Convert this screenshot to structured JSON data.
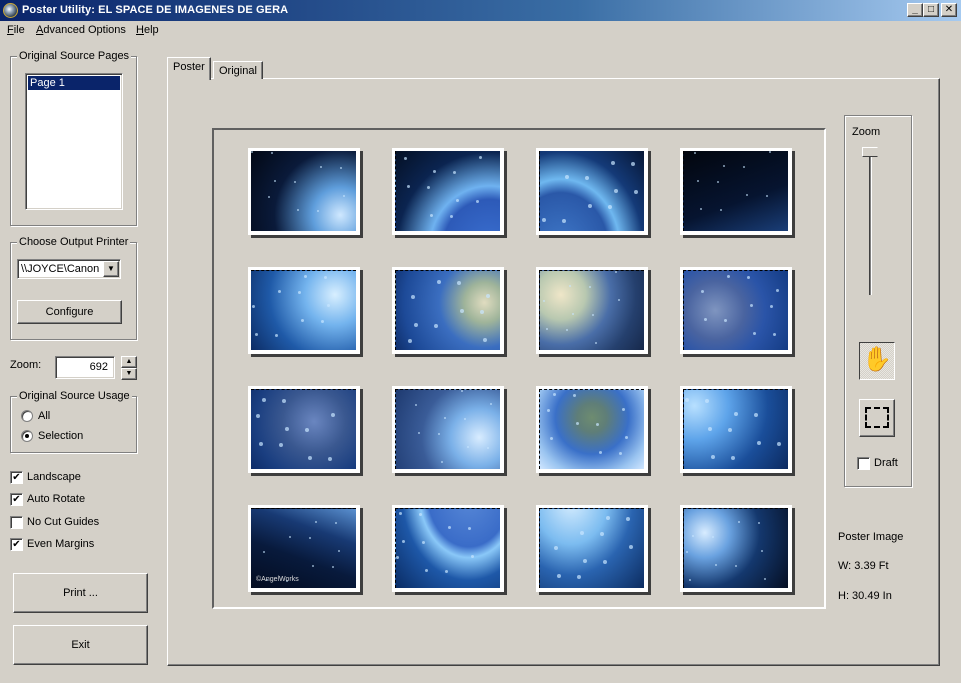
{
  "window": {
    "title": "Poster Utility:  EL SPACE DE IMAGENES DE GERA",
    "controls": {
      "minimize": "_",
      "maximize": "□",
      "close": "✕"
    }
  },
  "menubar": {
    "items": [
      {
        "label": "File",
        "accel": "F",
        "rest": "ile"
      },
      {
        "label": "Advanced Options",
        "accel": "A",
        "rest": "dvanced Options"
      },
      {
        "label": "Help",
        "accel": "H",
        "rest": "elp"
      }
    ]
  },
  "sidebar": {
    "source_pages": {
      "label": "Original Source Pages",
      "items": [
        "Page 1"
      ],
      "selected": "Page 1"
    },
    "printer": {
      "label": "Choose Output Printer",
      "selected": "\\\\JOYCE\\Canon iP",
      "arrow": "▼",
      "configure_label": "Configure"
    },
    "zoom": {
      "label": "Zoom:",
      "value": "692",
      "up": "▲",
      "down": "▼"
    },
    "source_usage": {
      "label": "Original Source Usage",
      "options": [
        {
          "label": "All",
          "selected": false
        },
        {
          "label": "Selection",
          "selected": true
        }
      ]
    },
    "options": [
      {
        "label": "Landscape",
        "checked": true,
        "mark": "✔"
      },
      {
        "label": "Auto Rotate",
        "checked": true,
        "mark": "✔"
      },
      {
        "label": "No Cut Guides",
        "checked": false,
        "mark": ""
      },
      {
        "label": "Even Margins",
        "checked": true,
        "mark": "✔"
      }
    ],
    "print_label": "Print ...",
    "exit_label": "Exit"
  },
  "tabs": [
    {
      "label": "Poster",
      "active": true
    },
    {
      "label": "Original",
      "active": false
    }
  ],
  "poster": {
    "grid_rows": 4,
    "grid_cols": 4,
    "tiles": [
      {
        "desc": "stars and bubbles",
        "bg": "radial-gradient(circle at 85% 80%, #cfe8ff 0%, #5f9edc 25%, #0a1a3a 60%, #020814 100%)"
      },
      {
        "desc": "earth horizon bubbles",
        "bg": "radial-gradient(ellipse at 90% 120%, #3a6fd0 0%, #2d5ab8 35%, #6fb2f0 45%, #0b2450 70%, #041024 100%)"
      },
      {
        "desc": "earth and stars",
        "bg": "radial-gradient(ellipse at 20% 120%, #3f78c8 0%, #2a58a8 40%, #6fb8f0 50%, #143a78 70%, #061634 100%)"
      },
      {
        "desc": "dark space",
        "bg": "linear-gradient(160deg, #02060e 0%, #061430 60%, #1a3e78 100%)"
      },
      {
        "desc": "bubbles and fin",
        "bg": "radial-gradient(circle at 80% 30%, #d8efff 0%, #74b4ee 30%, #1f5aa8 65%, #0c2c64 100%)"
      },
      {
        "desc": "earth with africa",
        "bg": "radial-gradient(circle at 85% 40%, #e0dcc0 0%, #9fb49a 20%, #3b6ec0 45%, #1d4a98 80%, #0f2e6a 100%)"
      },
      {
        "desc": "dolphin over earth",
        "bg": "radial-gradient(circle at 20% 30%, #efe6c8 0%, #b8c8b0 25%, #4a6ea8 50%, #25406e 75%, #16284a 100%)"
      },
      {
        "desc": "dolphin tail",
        "bg": "radial-gradient(circle at 30% 50%, #7f95c0 0%, #4a64a0 35%, #2a54a8 60%, #143c84 100%)"
      },
      {
        "desc": "dolphin body",
        "bg": "radial-gradient(circle at 60% 40%, #6a86c0 0%, #3a5890 40%, #1a3e80 75%, #0e2c68 100%)"
      },
      {
        "desc": "dolphin and bubbles",
        "bg": "radial-gradient(circle at 80% 60%, #d8ecff 0%, #7ab0e8 30%, #3a5c98 60%, #1e3a70 100%)"
      },
      {
        "desc": "earth africa bubbles",
        "bg": "radial-gradient(circle at 50% 35%, #6e8c70 0%, #5f7e78 20%, #3a70c8 50%, #9ac4f0 80%, #d0e6ff 100%)"
      },
      {
        "desc": "blue glow bubbles",
        "bg": "radial-gradient(circle at 10% 20%, #b8e0ff 0%, #5ea4ea 30%, #1a4e9a 65%, #0c2a60 100%)"
      },
      {
        "desc": "dark space fin",
        "bg": "linear-gradient(200deg, #5a90d0 0%, #183a74 30%, #081a3c 60%, #030c20 100%)",
        "credit": "©AngelWorks"
      },
      {
        "desc": "earth limb",
        "bg": "radial-gradient(ellipse at 70% -20%, #5a8ad8 0%, #3a6cc8 40%, #8ac8f8 48%, #1e58a8 65%, #0a2c64 100%)"
      },
      {
        "desc": "earth limb bubbles",
        "bg": "radial-gradient(ellipse at 30% -10%, #d8eeff 0%, #7cbcf0 35%, #2a64b0 60%, #0c2c60 100%)"
      },
      {
        "desc": "bubble cloud",
        "bg": "radial-gradient(circle at 20% 30%, #d8ecff 0%, #6aa2e0 25%, #14386e 55%, #050e22 100%)"
      }
    ]
  },
  "zoom_panel": {
    "label": "Zoom",
    "slider_fraction": 0.0,
    "hand_tool_active": true,
    "draft_label": "Draft",
    "draft_checked": false
  },
  "poster_info": {
    "title": "Poster Image",
    "width": "W: 3.39 Ft",
    "height": "H: 30.49 In"
  }
}
